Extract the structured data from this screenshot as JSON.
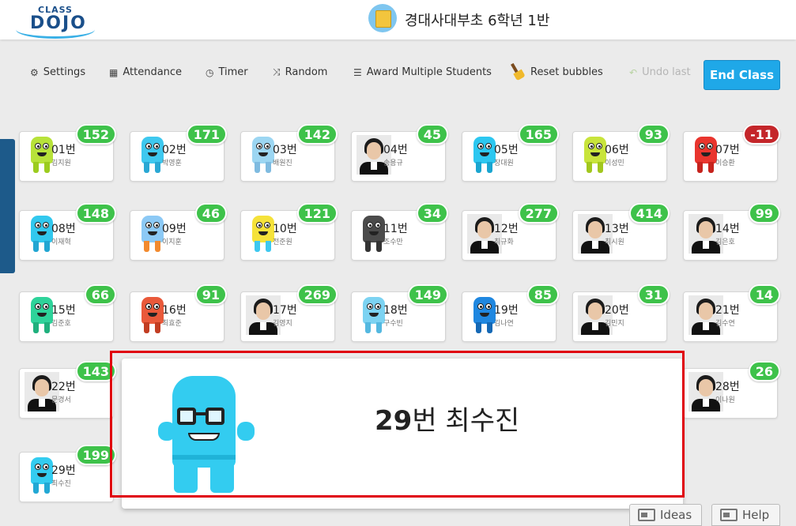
{
  "logo": {
    "line1": "CLASS",
    "line2": "DOJO"
  },
  "class_title": "경대사대부초 6학년 1반",
  "toolbar": {
    "settings": "Settings",
    "attendance": "Attendance",
    "timer": "Timer",
    "random": "Random",
    "award_multiple": "Award Multiple Students",
    "reset_bubbles": "Reset bubbles",
    "undo_last": "Undo last",
    "end_class": "End Class"
  },
  "students": [
    {
      "num": "01번",
      "name": "김지원",
      "points": "152",
      "avatar": "monster",
      "color": "#b7e23a",
      "legs": "#9ccc1f"
    },
    {
      "num": "02번",
      "name": "박영훈",
      "points": "171",
      "avatar": "monster",
      "color": "#3ec8ef",
      "legs": "#2aa8d4"
    },
    {
      "num": "03번",
      "name": "배원진",
      "points": "142",
      "avatar": "monster",
      "color": "#9cd6f2",
      "legs": "#7fbbe0"
    },
    {
      "num": "04번",
      "name": "송용규",
      "points": "45",
      "avatar": "photo"
    },
    {
      "num": "05번",
      "name": "장대원",
      "points": "165",
      "avatar": "monster",
      "color": "#2cc7f0",
      "legs": "#1aa5d0"
    },
    {
      "num": "06번",
      "name": "이성민",
      "points": "93",
      "avatar": "monster",
      "color": "#c8e43b",
      "legs": "#a2c71e"
    },
    {
      "num": "07번",
      "name": "이승환",
      "points": "-11",
      "avatar": "monster",
      "color": "#e9352e",
      "legs": "#c6231d"
    },
    {
      "num": "08번",
      "name": "이재혁",
      "points": "148",
      "avatar": "monster",
      "color": "#32c8ee",
      "legs": "#22a6d2"
    },
    {
      "num": "09번",
      "name": "이지훈",
      "points": "46",
      "avatar": "monster",
      "color": "#8cc9f5",
      "legs": "#f28a2e"
    },
    {
      "num": "10번",
      "name": "전준원",
      "points": "121",
      "avatar": "monster",
      "color": "#f5e23a",
      "legs": "#3ec8ef"
    },
    {
      "num": "11번",
      "name": "조수만",
      "points": "34",
      "avatar": "monster",
      "color": "#4b4b4b",
      "legs": "#333333"
    },
    {
      "num": "12번",
      "name": "최규화",
      "points": "277",
      "avatar": "photo"
    },
    {
      "num": "13번",
      "name": "최시원",
      "points": "414",
      "avatar": "photo"
    },
    {
      "num": "14번",
      "name": "김은호",
      "points": "99",
      "avatar": "photo"
    },
    {
      "num": "15번",
      "name": "김준호",
      "points": "66",
      "avatar": "monster",
      "color": "#2ed39a",
      "legs": "#1fb07d"
    },
    {
      "num": "16번",
      "name": "최효준",
      "points": "91",
      "avatar": "monster",
      "color": "#e9593a",
      "legs": "#c23d22"
    },
    {
      "num": "17번",
      "name": "김영지",
      "points": "269",
      "avatar": "photo"
    },
    {
      "num": "18번",
      "name": "구수빈",
      "points": "149",
      "avatar": "monster",
      "color": "#7cd3f2",
      "legs": "#54b8e0"
    },
    {
      "num": "19번",
      "name": "김나연",
      "points": "85",
      "avatar": "monster",
      "color": "#1f87e0",
      "legs": "#1468b5"
    },
    {
      "num": "20번",
      "name": "김민지",
      "points": "31",
      "avatar": "photo"
    },
    {
      "num": "21번",
      "name": "김수연",
      "points": "14",
      "avatar": "photo"
    },
    {
      "num": "22번",
      "name": "문경서",
      "points": "143",
      "avatar": "photo"
    },
    {
      "num": "28번",
      "name": "이나원",
      "points": "26",
      "avatar": "photo"
    },
    {
      "num": "29번",
      "name": "최수진",
      "points": "199",
      "avatar": "monster",
      "color": "#33ccf0",
      "legs": "#22a8d4"
    }
  ],
  "overlay": {
    "number": "29",
    "suffix": "번 최수진"
  },
  "footer": {
    "ideas": "Ideas",
    "help": "Help"
  }
}
